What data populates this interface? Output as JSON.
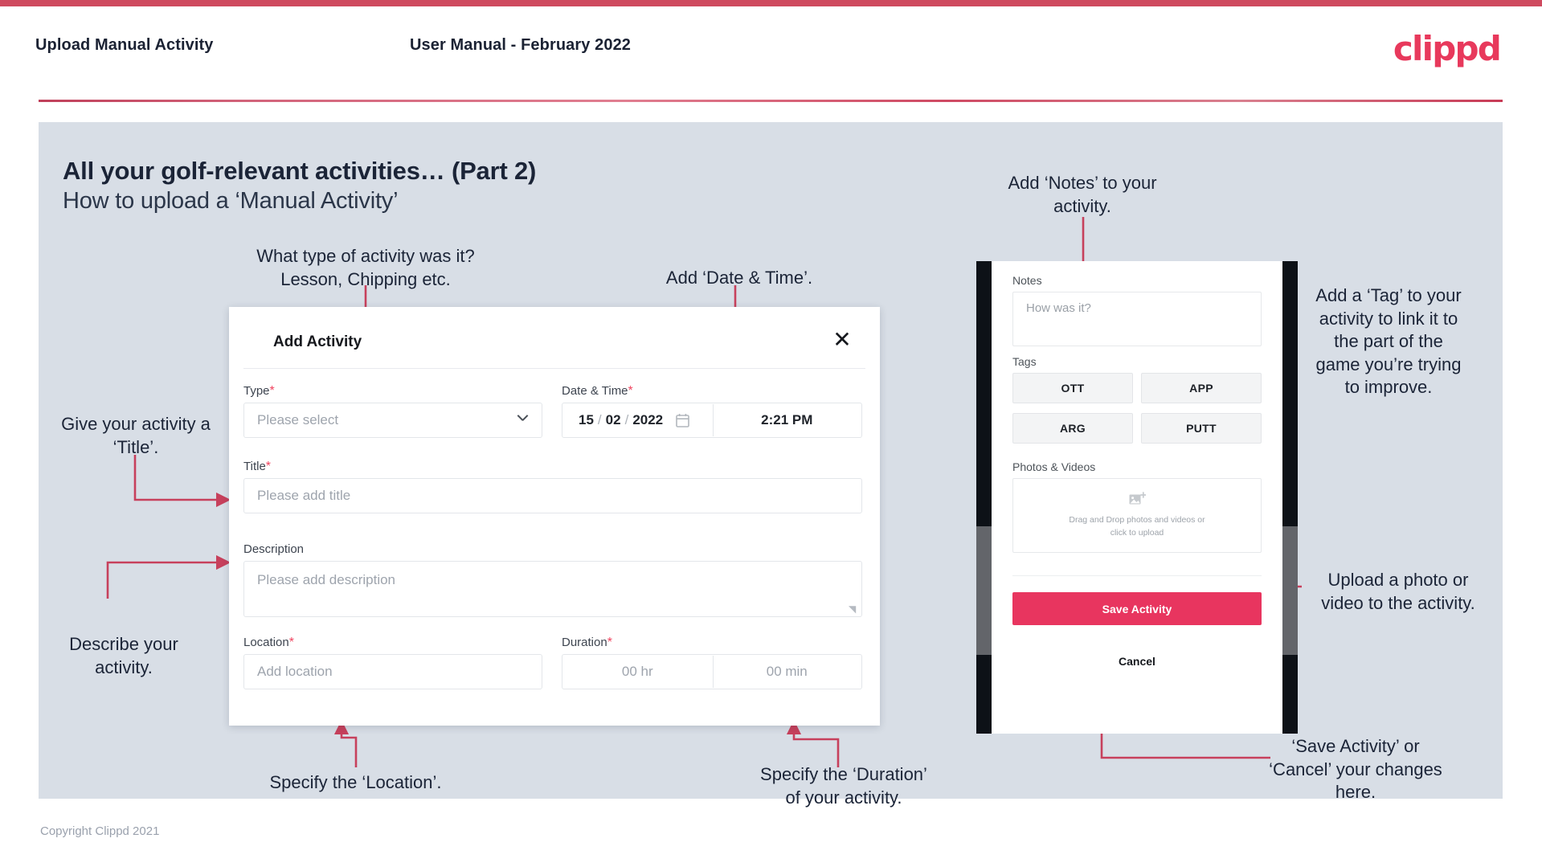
{
  "header": {
    "left_title": "Upload Manual Activity",
    "center_title": "User Manual - February 2022",
    "logo": "clippd"
  },
  "slide": {
    "heading_main": "All your golf-relevant activities… (Part 2)",
    "heading_sub": "How to upload a ‘Manual Activity’",
    "footer": "Copyright Clippd 2021"
  },
  "annotations": {
    "type": "What type of activity was it?\nLesson, Chipping etc.",
    "datetime": "Add ‘Date & Time’.",
    "title": "Give your activity a\n‘Title’.",
    "description": "Describe your\nactivity.",
    "location": "Specify the ‘Location’.",
    "duration": "Specify the ‘Duration’\nof your activity.",
    "notes": "Add ‘Notes’ to your\nactivity.",
    "tags": "Add a ‘Tag’ to your\nactivity to link it to\nthe part of the\ngame you’re trying\nto improve.",
    "upload": "Upload a photo or\nvideo to the activity.",
    "save_cancel": "‘Save Activity’ or\n‘Cancel’ your changes\nhere."
  },
  "dialog": {
    "title": "Add Activity",
    "close_icon": "close-icon",
    "fields": {
      "type": {
        "label": "Type",
        "required": "*",
        "placeholder": "Please select",
        "chevron_icon": "chevron-down-icon"
      },
      "datetime": {
        "label": "Date & Time",
        "required": "*",
        "day": "15",
        "sep1": "/",
        "month": "02",
        "sep2": "/",
        "year": "2022",
        "calendar_icon": "calendar-icon",
        "time": "2:21 PM"
      },
      "title": {
        "label": "Title",
        "required": "*",
        "placeholder": "Please add title"
      },
      "description": {
        "label": "Description",
        "required": "",
        "placeholder": "Please add description"
      },
      "location": {
        "label": "Location",
        "required": "*",
        "placeholder": "Add location"
      },
      "duration": {
        "label": "Duration",
        "required": "*",
        "hours_placeholder": "00 hr",
        "minutes_placeholder": "00 min"
      }
    }
  },
  "phone": {
    "notes": {
      "label": "Notes",
      "placeholder": "How was it?"
    },
    "tags": {
      "label": "Tags",
      "items": [
        "OTT",
        "APP",
        "ARG",
        "PUTT"
      ]
    },
    "photos": {
      "label": "Photos & Videos",
      "icon": "add-image-icon",
      "line1": "Drag and Drop photos and videos or",
      "line2": "click to upload"
    },
    "save_label": "Save Activity",
    "cancel_label": "Cancel"
  },
  "colors": {
    "brand_pink": "#e8355f",
    "header_rule": "#cf4a5f",
    "slide_bg": "#d8dee6",
    "annotation_arrow": "#c7405c",
    "text_dark": "#1b2437"
  }
}
